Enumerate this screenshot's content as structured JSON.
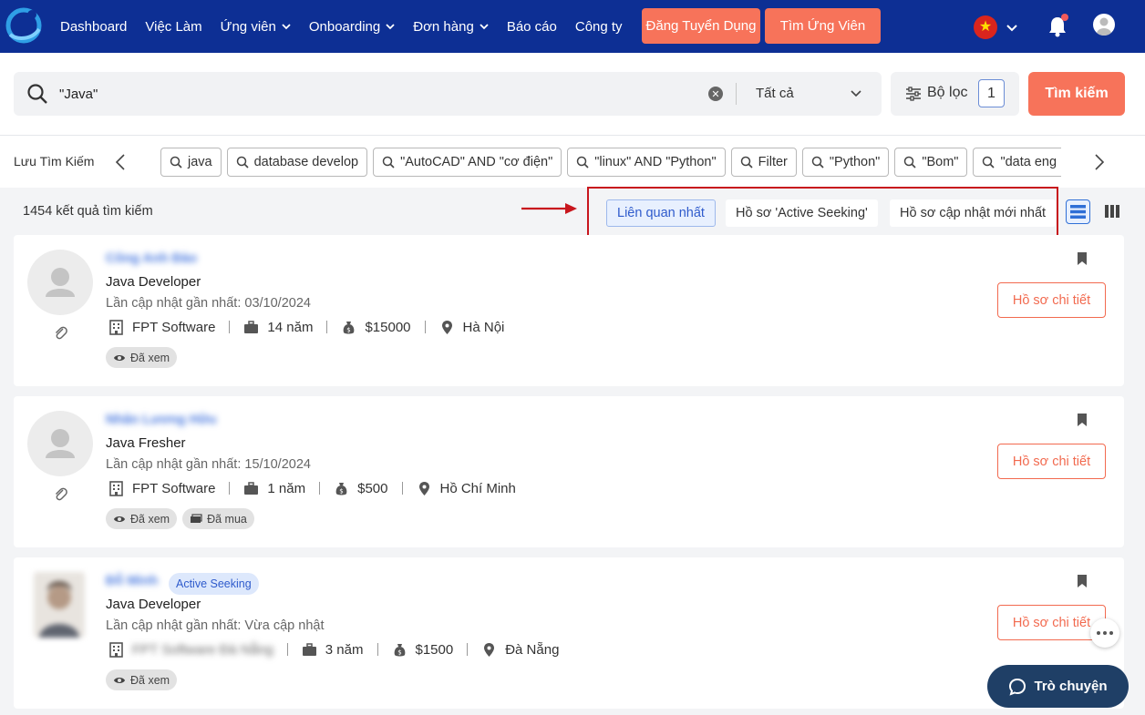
{
  "nav": {
    "items": [
      {
        "label": "Dashboard",
        "dropdown": false
      },
      {
        "label": "Việc Làm",
        "dropdown": false
      },
      {
        "label": "Ứng viên",
        "dropdown": true
      },
      {
        "label": "Onboarding",
        "dropdown": true
      },
      {
        "label": "Đơn hàng",
        "dropdown": true
      },
      {
        "label": "Báo cáo",
        "dropdown": false
      },
      {
        "label": "Công ty",
        "dropdown": false
      }
    ],
    "post_job": "Đăng Tuyển Dụng",
    "find_candidate": "Tìm Ứng Viên",
    "brand_color": "#0d2f94",
    "accent_color": "#f7735a"
  },
  "search": {
    "query": "\"Java\"",
    "scope": "Tất cả",
    "filter_label": "Bộ lọc",
    "filter_count": "1",
    "submit": "Tìm kiếm"
  },
  "saved": {
    "label": "Lưu Tìm Kiếm",
    "chips": [
      "java",
      "database develop",
      "\"AutoCAD\" AND \"cơ điện\"",
      "\"linux\" AND \"Python\"",
      "Filter",
      "\"Python\"",
      "\"Bom\"",
      "\"data eng"
    ]
  },
  "results": {
    "count_text": "1454 kết quả tìm kiếm",
    "sort_options": [
      "Liên quan nhất",
      "Hồ sơ 'Active Seeking'",
      "Hồ sơ cập nhật mới nhất"
    ],
    "active_sort": 0
  },
  "candidates": [
    {
      "name": "Công Anh Đào",
      "active_seeking": "",
      "title": "Java Developer",
      "updated": "Lần cập nhật gần nhất: 03/10/2024",
      "company": "FPT Software",
      "experience": "14 năm",
      "salary": "$15000",
      "location": "Hà Nội",
      "tags": [
        "Đã xem"
      ],
      "detail": "Hồ sơ chi tiết"
    },
    {
      "name": "Nhân Lương Hữu",
      "active_seeking": "",
      "title": "Java Fresher",
      "updated": "Lần cập nhật gần nhất: 15/10/2024",
      "company": "FPT Software",
      "experience": "1 năm",
      "salary": "$500",
      "location": "Hồ Chí Minh",
      "tags": [
        "Đã xem",
        "Đã mua"
      ],
      "detail": "Hồ sơ chi tiết"
    },
    {
      "name": "Đỗ Minh",
      "active_seeking": "Active Seeking",
      "title": "Java Developer",
      "updated": "Lần cập nhật gần nhất: Vừa cập nhật",
      "company": "FPT Software Đà Nẵng",
      "experience": "3 năm",
      "salary": "$1500",
      "location": "Đà Nẵng",
      "tags": [
        "Đã xem"
      ],
      "detail": "Hồ sơ chi tiết"
    }
  ],
  "chat": {
    "label": "Trò chuyện"
  }
}
